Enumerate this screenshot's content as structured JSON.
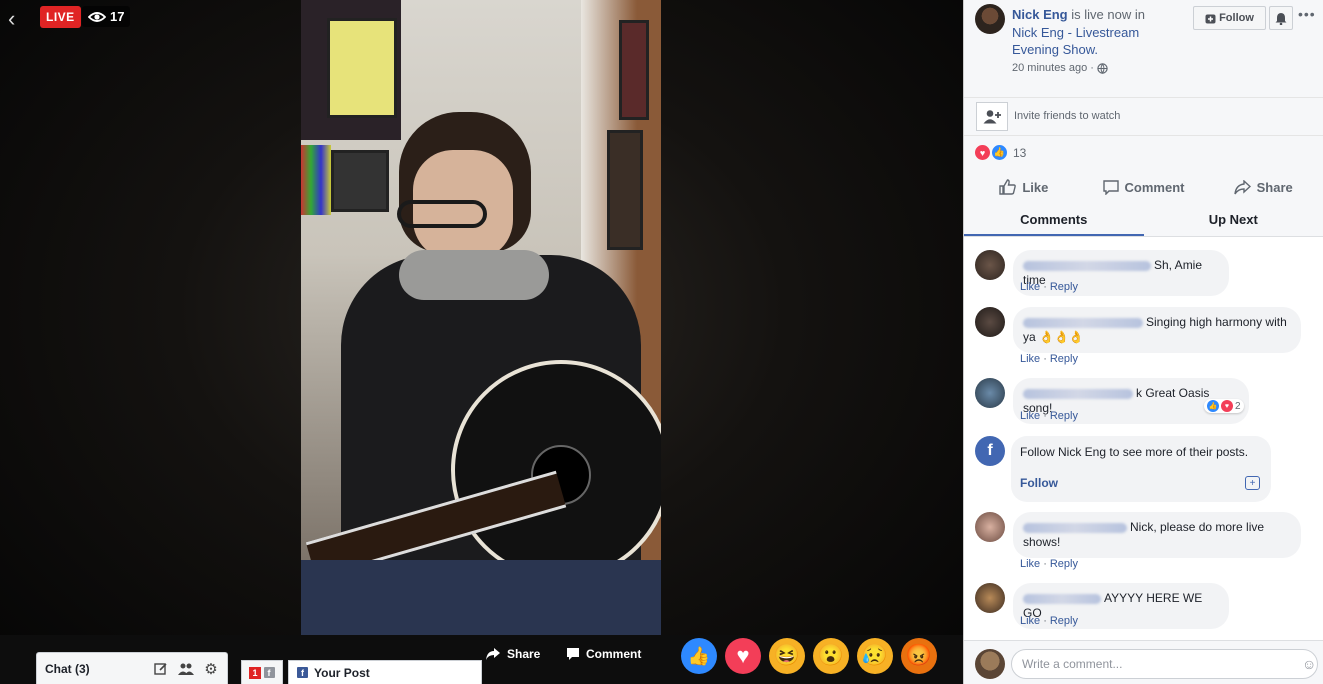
{
  "video": {
    "live_label": "LIVE",
    "viewer_count": "17",
    "back_icon": "back-arrow-icon",
    "eye_icon": "eye-icon"
  },
  "bottom_bar": {
    "chat_label": "Chat (3)",
    "chat_icons": [
      "compose-icon",
      "people-icon",
      "gear-icon"
    ],
    "mini_tab_count": "1",
    "your_post_label": "Your Post",
    "share_label": "Share",
    "comment_label": "Comment",
    "reactions": [
      {
        "name": "like",
        "emoji": "👍",
        "color": "#2e89ff"
      },
      {
        "name": "love",
        "emoji": "♥",
        "color": "#f33e58"
      },
      {
        "name": "haha",
        "emoji": "😆",
        "color": "#f7b125"
      },
      {
        "name": "wow",
        "emoji": "😮",
        "color": "#f7b125"
      },
      {
        "name": "sad",
        "emoji": "😥",
        "color": "#f7b125"
      },
      {
        "name": "angry",
        "emoji": "😡",
        "color": "#e9710f"
      }
    ]
  },
  "sidebar": {
    "host_name": "Nick Eng",
    "live_text": " is live now in ",
    "page_name": "Nick Eng - Livestream Evening Show.",
    "time": "20 minutes ago ·",
    "follow_label": "Follow",
    "invite_text": "Invite friends to watch",
    "reaction_count": "13",
    "actions": {
      "like": "Like",
      "comment": "Comment",
      "share": "Share"
    },
    "tabs": {
      "comments": "Comments",
      "up_next": "Up Next"
    },
    "comments": [
      {
        "text": "Sh, Amie time",
        "like": "Like",
        "reply": "Reply"
      },
      {
        "text": "Singing high harmony with ya 👌👌👌",
        "like": "Like",
        "reply": "Reply"
      },
      {
        "text": "k Great Oasis song!",
        "like": "Like",
        "reply": "Reply",
        "reaction_count": "2"
      },
      {
        "text": "Nick, please do more live shows!",
        "like": "Like",
        "reply": "Reply"
      },
      {
        "text": "AYYYY HERE WE GO",
        "like": "Like",
        "reply": "Reply"
      }
    ],
    "follow_card": {
      "message": "Follow Nick Eng to see more of their posts.",
      "link": "Follow"
    },
    "compose_placeholder": "Write a comment..."
  },
  "colors": {
    "live_red": "#e02424",
    "fb_blue": "#4267b2",
    "link_blue": "#365899"
  }
}
